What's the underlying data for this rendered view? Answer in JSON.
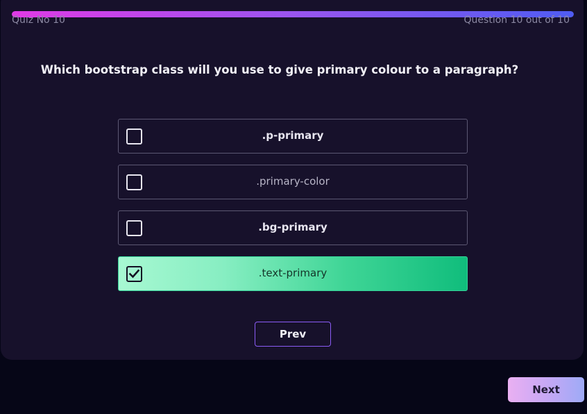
{
  "quiz": {
    "progress": 1.0,
    "quiz_label": "Quiz No 10",
    "question_counter": "Question 10 out of 10",
    "question": "Which bootstrap class will you use to give primary colour to a paragraph?"
  },
  "options": [
    {
      "label": ".p-primary",
      "selected": false
    },
    {
      "label": ".primary-color",
      "selected": false
    },
    {
      "label": ".bg-primary",
      "selected": false
    },
    {
      "label": ".text-primary",
      "selected": true
    }
  ],
  "buttons": {
    "prev_label": "Prev",
    "next_label": "Next"
  },
  "colors": {
    "background": "#060617",
    "card": "#17112b",
    "progress_start": "#e03ae6",
    "progress_end": "#4f5cf2",
    "selected_option_start": "#a7f8d2",
    "selected_option_end": "#10bd7c",
    "prev_border": "#8b5cf6"
  },
  "icons": {
    "checkbox_checked": "check-icon"
  }
}
